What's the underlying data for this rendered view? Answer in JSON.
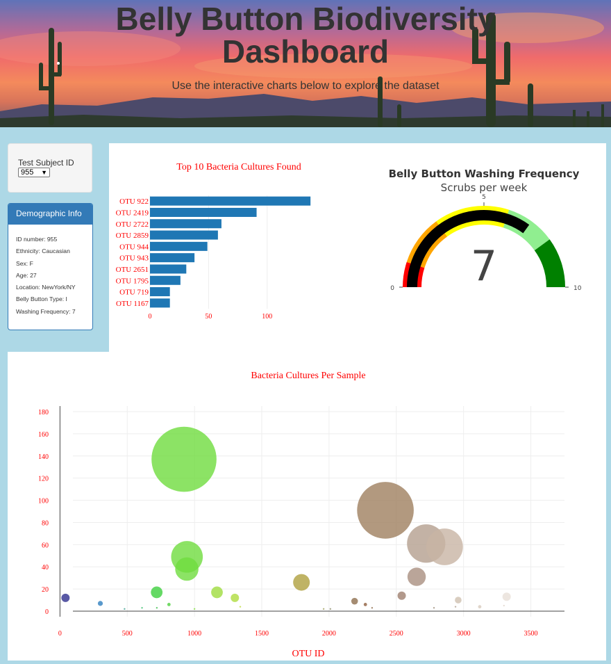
{
  "header": {
    "title_line1": "Belly Button Biodiversity",
    "title_line2": "Dashboard",
    "subtitle": "Use the interactive charts below to explore the dataset"
  },
  "selector": {
    "label": "Test Subject ID No.:",
    "value": "955"
  },
  "demographics": {
    "title": "Demographic Info",
    "rows": [
      "ID number: 955",
      "Ethnicity: Caucasian",
      "Sex: F",
      "Age: 27",
      "Location: NewYork/NY",
      "Belly Button Type: I",
      "Washing Frequency: 7"
    ]
  },
  "colors": {
    "accent": "#337ab7",
    "bar": "#1f77b4",
    "chart_text": "#ff0000"
  },
  "chart_data": [
    {
      "type": "bar",
      "orientation": "horizontal",
      "title": "Top 10 Bacteria Cultures Found",
      "categories": [
        "OTU 922",
        "OTU 2419",
        "OTU 2722",
        "OTU 2859",
        "OTU 944",
        "OTU 943",
        "OTU 2651",
        "OTU 1795",
        "OTU 719",
        "OTU 1167"
      ],
      "values": [
        137,
        91,
        61,
        58,
        49,
        38,
        31,
        26,
        17,
        17
      ],
      "xticks": [
        0,
        50,
        100
      ],
      "xlim": [
        0,
        144
      ],
      "grid": true
    },
    {
      "type": "gauge",
      "title": "Belly Button Washing Frequency",
      "subtitle": "Scrubs per week",
      "value": 7,
      "range": [
        0,
        10
      ],
      "tick_labels": [
        "0",
        "5",
        "10"
      ],
      "steps": [
        {
          "range": [
            0,
            1
          ],
          "color": "#ff0000"
        },
        {
          "range": [
            1,
            3
          ],
          "color": "#ffa500"
        },
        {
          "range": [
            3,
            6
          ],
          "color": "#ffff00"
        },
        {
          "range": [
            6,
            8
          ],
          "color": "#90ee90"
        },
        {
          "range": [
            8,
            10
          ],
          "color": "#008000"
        }
      ],
      "bar_color": "#000000"
    },
    {
      "type": "scatter",
      "mode": "bubble",
      "title": "Bacteria Cultures Per Sample",
      "xlabel": "OTU ID",
      "xlim": [
        -100,
        3750
      ],
      "ylim": [
        -5,
        185
      ],
      "xticks": [
        0,
        500,
        1000,
        1500,
        2000,
        2500,
        3000,
        3500
      ],
      "yticks": [
        0,
        20,
        40,
        60,
        80,
        100,
        120,
        140,
        160,
        180
      ],
      "grid": true,
      "points": [
        {
          "x": 41,
          "y": 12,
          "color": "#2f2f8f"
        },
        {
          "x": 300,
          "y": 7,
          "color": "#2f7fbf"
        },
        {
          "x": 480,
          "y": 2,
          "color": "#3f9f8f"
        },
        {
          "x": 610,
          "y": 3,
          "color": "#3fbf6f"
        },
        {
          "x": 720,
          "y": 3,
          "color": "#3fbf4f"
        },
        {
          "x": 719,
          "y": 17,
          "color": "#3fcf3f"
        },
        {
          "x": 810,
          "y": 6,
          "color": "#4fcf3f"
        },
        {
          "x": 922,
          "y": 137,
          "color": "#6fdc3f"
        },
        {
          "x": 943,
          "y": 38,
          "color": "#6fdc3f"
        },
        {
          "x": 944,
          "y": 49,
          "color": "#6fdc3f"
        },
        {
          "x": 1000,
          "y": 2,
          "color": "#7fdc3f"
        },
        {
          "x": 1167,
          "y": 17,
          "color": "#9fdc3f"
        },
        {
          "x": 1300,
          "y": 12,
          "color": "#afdc3f"
        },
        {
          "x": 1340,
          "y": 4,
          "color": "#bfdc3f"
        },
        {
          "x": 1795,
          "y": 26,
          "color": "#afa03f"
        },
        {
          "x": 1960,
          "y": 2,
          "color": "#9f9f5f"
        },
        {
          "x": 2010,
          "y": 2,
          "color": "#8f8f6f"
        },
        {
          "x": 2190,
          "y": 9,
          "color": "#8f6f4f"
        },
        {
          "x": 2270,
          "y": 6,
          "color": "#8f5f3f"
        },
        {
          "x": 2320,
          "y": 3,
          "color": "#8f6f4f"
        },
        {
          "x": 2419,
          "y": 91,
          "color": "#9f7f5f"
        },
        {
          "x": 2540,
          "y": 14,
          "color": "#9f7f6f"
        },
        {
          "x": 2651,
          "y": 31,
          "color": "#a98f7f"
        },
        {
          "x": 2722,
          "y": 61,
          "color": "#b49f8f"
        },
        {
          "x": 2780,
          "y": 3,
          "color": "#a09080"
        },
        {
          "x": 2859,
          "y": 58,
          "color": "#c8b4a4"
        },
        {
          "x": 2940,
          "y": 4,
          "color": "#b0a090"
        },
        {
          "x": 2960,
          "y": 10,
          "color": "#d0c0b0"
        },
        {
          "x": 3120,
          "y": 4,
          "color": "#d8cbbd"
        },
        {
          "x": 3300,
          "y": 5,
          "color": "#e0d6cb"
        },
        {
          "x": 3320,
          "y": 13,
          "color": "#e8e0d8"
        }
      ],
      "sizes": [
        5,
        3,
        1,
        1,
        1,
        7,
        2,
        39,
        14,
        19,
        1,
        7,
        5,
        1,
        10,
        1,
        1,
        4,
        2,
        1,
        34,
        5,
        11,
        23,
        1,
        22,
        1,
        4,
        2,
        1,
        5
      ]
    }
  ]
}
